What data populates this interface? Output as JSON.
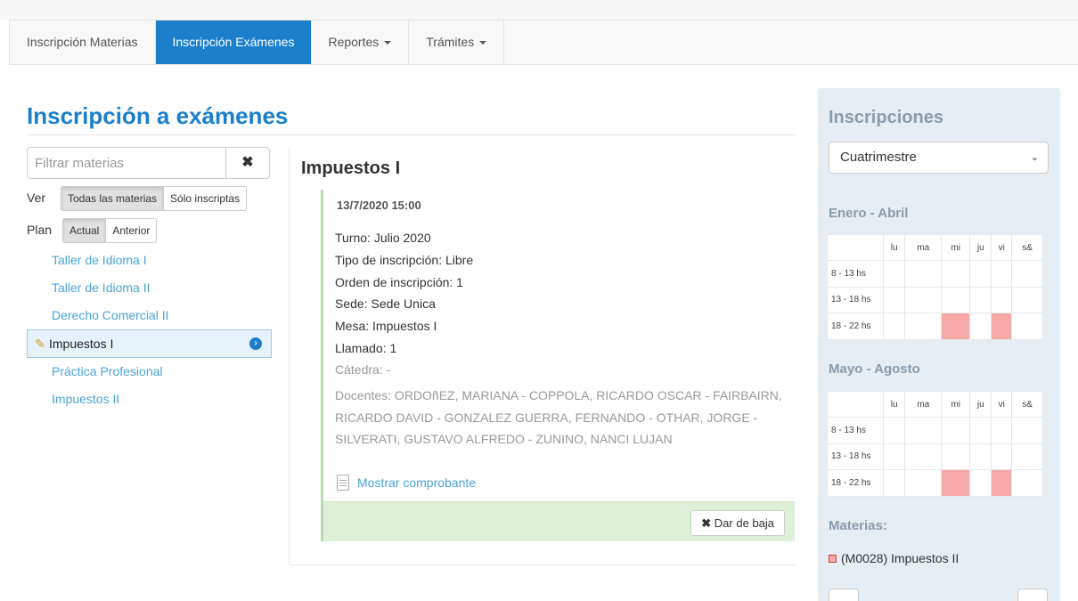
{
  "nav": {
    "items": [
      {
        "label": "Inscripción Materias"
      },
      {
        "label": "Inscripción Exámenes"
      },
      {
        "label": "Reportes"
      },
      {
        "label": "Trámites"
      }
    ]
  },
  "page": {
    "title": "Inscripción a exámenes"
  },
  "filter": {
    "placeholder": "Filtrar materias",
    "clear_icon": "✖"
  },
  "ver": {
    "label": "Ver",
    "options": [
      "Todas las materias",
      "Sólo inscriptas"
    ],
    "selected": "Todas las materias"
  },
  "plan": {
    "label": "Plan",
    "options": [
      "Actual",
      "Anterior"
    ],
    "selected": "Actual"
  },
  "subjects": [
    {
      "label": "Taller de Idioma I"
    },
    {
      "label": "Taller de Idioma II"
    },
    {
      "label": "Derecho Comercial II"
    },
    {
      "label": "Impuestos I",
      "active": true
    },
    {
      "label": "Práctica Profesional"
    },
    {
      "label": "Impuestos II"
    }
  ],
  "detail": {
    "title": "Impuestos I",
    "date": "13/7/2020 15:00",
    "turno": "Turno: Julio 2020",
    "tipo": "Tipo de inscripción: Libre",
    "orden": "Orden de inscripción: 1",
    "sede": "Sede: Sede Unica",
    "mesa": "Mesa: Impuestos I",
    "llamado": "Llamado: 1",
    "catedra": "Cátedra: -",
    "docentes": "Docentes: ORDOñEZ, MARIANA - COPPOLA, RICARDO OSCAR - FAIRBAIRN, RICARDO DAVID - GONZALEZ GUERRA, FERNANDO - OTHAR, JORGE - SILVERATI, GUSTAVO ALFREDO - ZUNINO, NANCI LUJAN",
    "comprobante": "Mostrar comprobante",
    "baja_icon": "✖",
    "baja_label": "Dar de baja"
  },
  "sidebar": {
    "title": "Inscripciones",
    "select_value": "Cuatrimestre",
    "days": [
      "lu",
      "ma",
      "mi",
      "ju",
      "vi",
      "s&"
    ],
    "periods": [
      {
        "name": "Enero - Abril",
        "rows": [
          {
            "label": "8 - 13 hs",
            "busy": []
          },
          {
            "label": "13 - 18 hs",
            "busy": []
          },
          {
            "label": "18 - 22 hs",
            "busy": [
              "mi",
              "vi"
            ]
          }
        ]
      },
      {
        "name": "Mayo - Agosto",
        "rows": [
          {
            "label": "8 - 13 hs",
            "busy": []
          },
          {
            "label": "13 - 18 hs",
            "busy": []
          },
          {
            "label": "18 - 22 hs",
            "busy": [
              "mi",
              "vi"
            ]
          }
        ]
      }
    ],
    "materias_title": "Materias:",
    "materias": [
      "(M0028) Impuestos II"
    ],
    "busy_color": "#f7a8a8"
  },
  "colors": {
    "accent": "#1b7fcc",
    "link": "#4aa3d8",
    "success_bg": "#dff0d8"
  }
}
